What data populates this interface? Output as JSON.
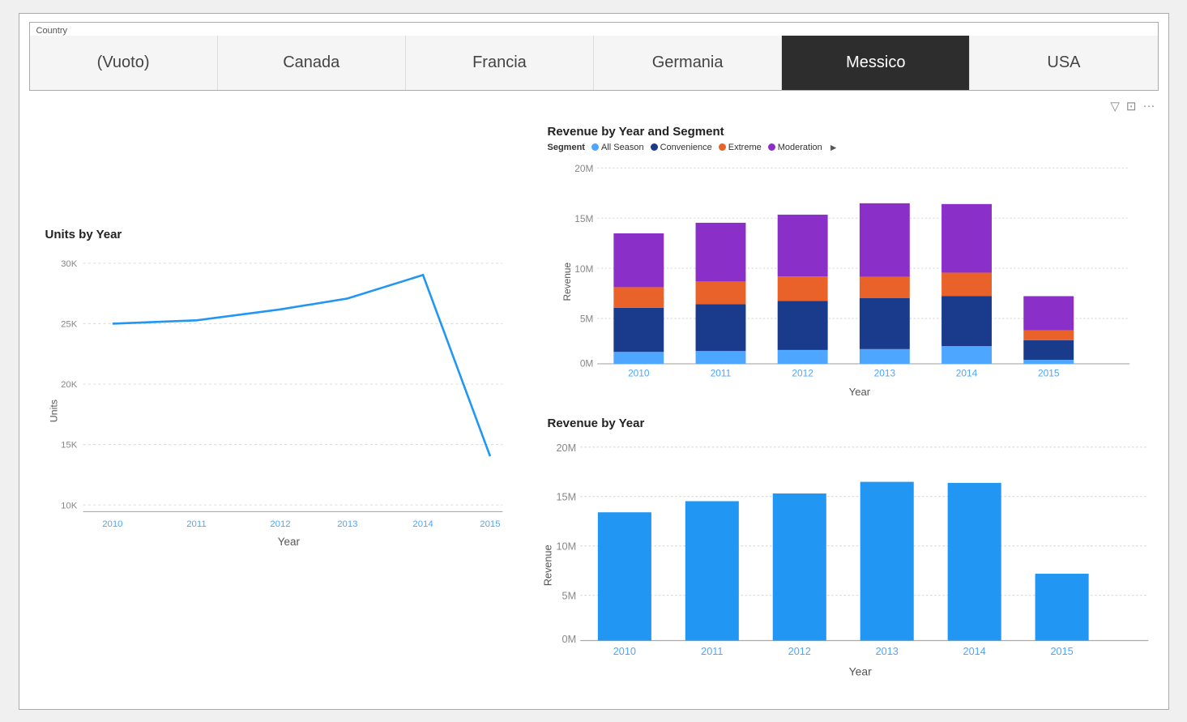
{
  "country_slicer": {
    "label": "Country",
    "tabs": [
      {
        "id": "vuoto",
        "label": "(Vuoto)",
        "active": false
      },
      {
        "id": "canada",
        "label": "Canada",
        "active": false
      },
      {
        "id": "francia",
        "label": "Francia",
        "active": false
      },
      {
        "id": "germania",
        "label": "Germania",
        "active": false
      },
      {
        "id": "messico",
        "label": "Messico",
        "active": true
      },
      {
        "id": "usa",
        "label": "USA",
        "active": false
      }
    ]
  },
  "toolbar": {
    "filter_icon": "▽",
    "expand_icon": "⊡",
    "more_icon": "···"
  },
  "revenue_by_year_segment": {
    "title": "Revenue by Year and Segment",
    "legend_label": "Segment",
    "legend_items": [
      {
        "label": "All Season",
        "color": "#4da6ff"
      },
      {
        "label": "Convenience",
        "color": "#1a3a8c"
      },
      {
        "label": "Extreme",
        "color": "#e8622a"
      },
      {
        "label": "Moderation",
        "color": "#8b2fc9"
      }
    ],
    "y_labels": [
      "20M",
      "15M",
      "10M",
      "5M",
      "0M"
    ],
    "x_labels": [
      "2010",
      "2011",
      "2012",
      "2013",
      "2014",
      "2015"
    ],
    "x_axis_label": "Year",
    "y_axis_label": "Revenue",
    "bars": [
      {
        "year": "2010",
        "allSeason": 1.2,
        "convenience": 4.5,
        "extreme": 2.1,
        "moderation": 5.5
      },
      {
        "year": "2011",
        "allSeason": 1.3,
        "convenience": 4.8,
        "extreme": 2.3,
        "moderation": 6.0
      },
      {
        "year": "2012",
        "allSeason": 1.4,
        "convenience": 5.0,
        "extreme": 2.5,
        "moderation": 6.3
      },
      {
        "year": "2013",
        "allSeason": 1.5,
        "convenience": 5.2,
        "extreme": 2.2,
        "moderation": 7.5
      },
      {
        "year": "2014",
        "allSeason": 1.8,
        "convenience": 5.1,
        "extreme": 2.4,
        "moderation": 7.0
      },
      {
        "year": "2015",
        "allSeason": 0.4,
        "convenience": 2.0,
        "extreme": 1.0,
        "moderation": 3.5
      }
    ]
  },
  "revenue_by_year": {
    "title": "Revenue by Year",
    "y_labels": [
      "20M",
      "15M",
      "10M",
      "5M",
      "0M"
    ],
    "x_labels": [
      "2010",
      "2011",
      "2012",
      "2013",
      "2014",
      "2015"
    ],
    "x_axis_label": "Year",
    "y_axis_label": "Revenue",
    "bars": [
      {
        "year": "2010",
        "value": 13.3
      },
      {
        "year": "2011",
        "value": 14.4
      },
      {
        "year": "2012",
        "value": 15.2
      },
      {
        "year": "2013",
        "value": 16.4
      },
      {
        "year": "2014",
        "value": 16.3
      },
      {
        "year": "2015",
        "value": 6.9
      }
    ],
    "bar_color": "#2196f3"
  },
  "units_by_year": {
    "title": "Units by Year",
    "y_labels": [
      "30K",
      "25K",
      "20K",
      "15K",
      "10K"
    ],
    "x_labels": [
      "2010",
      "2011",
      "2012",
      "2013",
      "2014",
      "2015"
    ],
    "x_axis_label": "Year",
    "y_axis_label": "Units",
    "line_color": "#2196f3",
    "points": [
      {
        "year": "2010",
        "value": 25000
      },
      {
        "year": "2011",
        "value": 25300
      },
      {
        "year": "2012",
        "value": 26200
      },
      {
        "year": "2013",
        "value": 27100
      },
      {
        "year": "2014",
        "value": 29000
      },
      {
        "year": "2015",
        "value": 14000
      }
    ]
  }
}
